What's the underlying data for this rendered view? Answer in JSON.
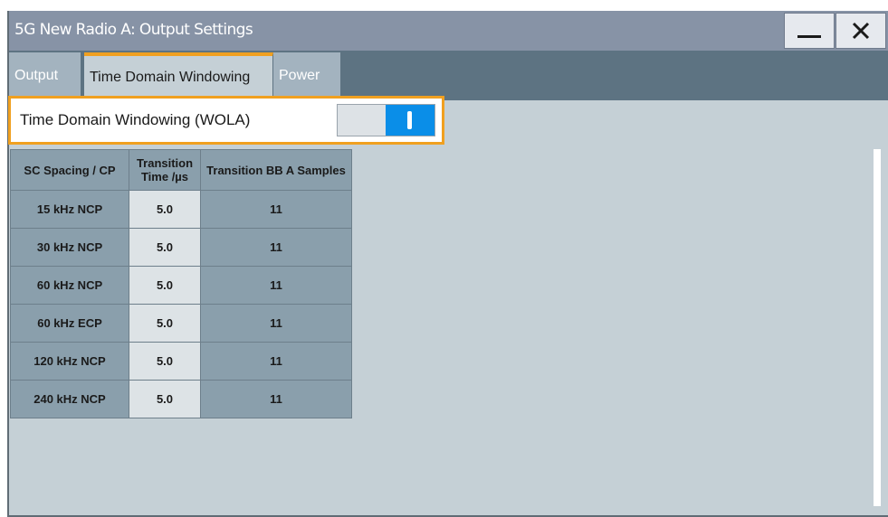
{
  "window": {
    "title": "5G New Radio A: Output Settings"
  },
  "titlebar_buttons": {
    "minimize_icon": "minimize-icon",
    "close_icon": "close-icon"
  },
  "tabs": [
    {
      "label": "Output"
    },
    {
      "label": "Time Domain Windowing",
      "active": true
    },
    {
      "label": "Power"
    }
  ],
  "wola": {
    "label": "Time Domain Windowing (WOLA)",
    "state": "on"
  },
  "table": {
    "headers": [
      "SC Spacing / CP",
      "Transition Time /µs",
      "Transition BB A Samples"
    ],
    "rows": [
      {
        "sc": "15 kHz NCP",
        "time": "5.0",
        "samples": "11"
      },
      {
        "sc": "30 kHz NCP",
        "time": "5.0",
        "samples": "11"
      },
      {
        "sc": "60 kHz NCP",
        "time": "5.0",
        "samples": "11"
      },
      {
        "sc": "60 kHz ECP",
        "time": "5.0",
        "samples": "11"
      },
      {
        "sc": "120 kHz NCP",
        "time": "5.0",
        "samples": "11"
      },
      {
        "sc": "240 kHz NCP",
        "time": "5.0",
        "samples": "11"
      }
    ]
  },
  "colors": {
    "accent": "#f0a020",
    "toggle_on": "#0a8ee8",
    "titlebar": "#8793a6",
    "tabbar": "#5d7382"
  }
}
